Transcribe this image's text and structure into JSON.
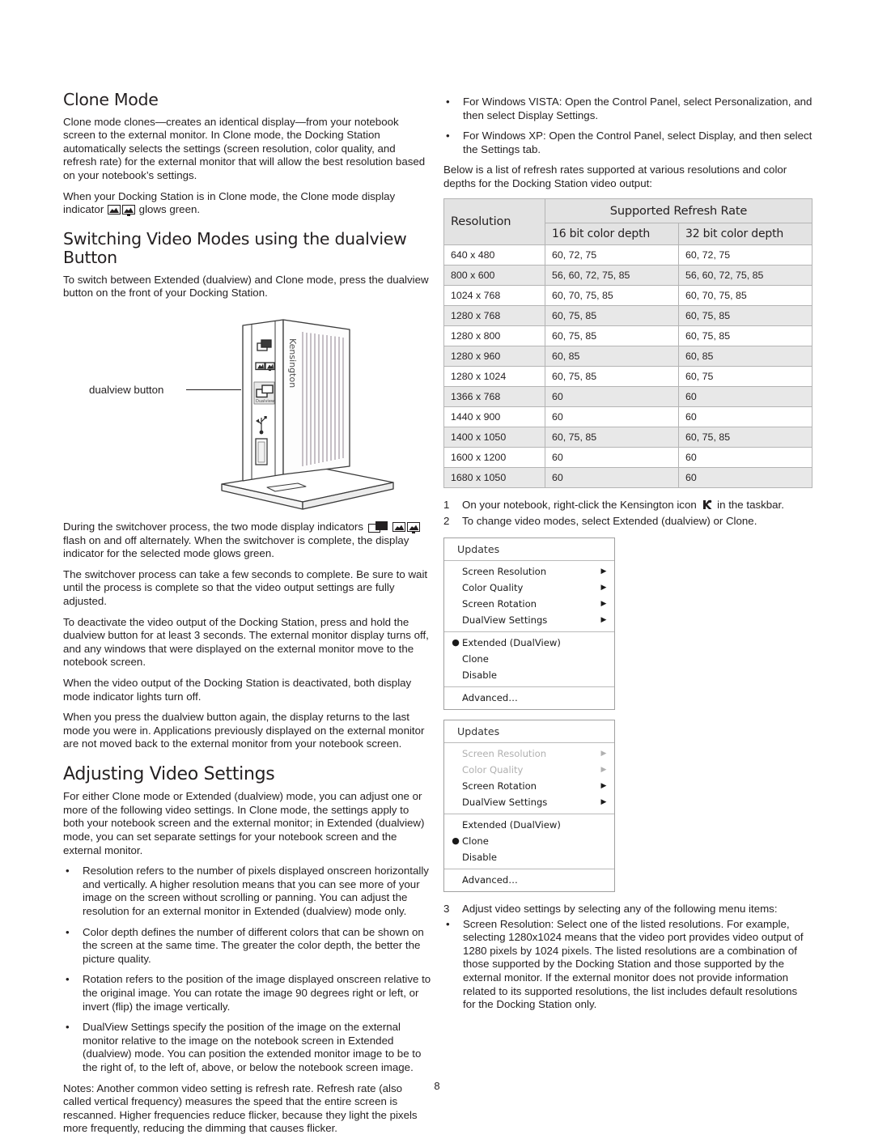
{
  "left": {
    "clone_heading": "Clone Mode",
    "clone_p1": "Clone mode clones—creates an identical display—from your notebook screen to the external monitor. In Clone mode, the Docking Station automatically selects the settings (screen resolution, color quality, and refresh rate) for the external monitor that will allow the best resolution based on your notebook’s settings.",
    "clone_p2_a": "When your Docking Station is in Clone mode, the Clone mode display indicator",
    "clone_p2_b": "glows green.",
    "switch_heading": "Switching Video Modes using the dualview Button",
    "switch_p1": "To switch between Extended (dualview) and Clone mode, press the dualview button on the front of your Docking Station.",
    "figure_callout": "dualview button",
    "figure_brandtext": "Kensington",
    "figure_button_label": "Dualview",
    "switchover_a": "During the switchover process, the two mode display indicators",
    "switchover_b": "flash on and off alternately. When the switchover is complete, the display indicator for the selected mode glows green.",
    "p_wait": "The switchover process can take a few seconds to complete. Be sure to wait until the process is complete so that the video output settings are fully adjusted.",
    "p_deactivate": "To deactivate the video output of the Docking Station, press and hold the dualview button for at least 3 seconds. The external monitor display turns off, and any windows that were displayed on the external monitor move to the notebook screen.",
    "p_lightsoff": "When the video output of the Docking Station is deactivated, both display mode indicator lights turn off.",
    "p_pressagain": "When you press the dualview button again, the display returns to the last mode you were in. Applications previously displayed on the external monitor are not moved back to the external monitor from your notebook screen.",
    "adjust_heading": "Adjusting Video Settings",
    "adjust_p1": "For either Clone mode or Extended (dualview) mode, you can adjust one or more of the following video settings. In Clone mode, the settings apply to both your notebook screen and the external monitor; in Extended (dualview) mode, you can set separate settings for your notebook screen and the external monitor.",
    "bullet_marker": "•",
    "bullets": [
      "Resolution refers to the number of pixels displayed onscreen horizontally and vertically. A higher resolution means that you can see more of your image on the screen without scrolling or panning. You can adjust the resolution for an external monitor in Extended (dualview) mode only.",
      "Color depth defines the number of different colors that can be shown on the screen at the same time. The greater the color depth, the better the picture quality.",
      "Rotation refers to the position of the image displayed onscreen relative to the original image. You can rotate the image 90 degrees right or left, or invert (flip) the image vertically.",
      "DualView Settings specify the position of the image on the external monitor relative to the image on the notebook screen in Extended (dualview) mode. You can position the extended monitor image to be to the right of, to the left of, above, or below the notebook screen image."
    ],
    "notes": "Notes: Another common video setting is refresh rate. Refresh rate (also called vertical frequency) measures the speed that the entire screen is rescanned. Higher frequencies reduce flicker, because they light the pixels more frequently, reducing the dimming that causes flicker."
  },
  "right": {
    "bullet_marker": "•",
    "os_bullets": [
      "For Windows VISTA: Open the Control Panel, select Personalization, and then select Display Settings.",
      "For Windows XP: Open the Control Panel, select Display, and then select the Settings tab."
    ],
    "intro": "Below is a list of refresh rates supported at various resolutions and color depths for the Docking Station video output:",
    "steps": [
      {
        "n": "1",
        "a": "On your notebook, right-click the Kensington icon",
        "b": "in the taskbar."
      },
      {
        "n": "2",
        "a": "To change video modes, select Extended (dualview) or Clone.",
        "b": ""
      }
    ],
    "step3": {
      "n": "3",
      "text": "Adjust video settings by selecting any of the following menu items:"
    },
    "step3_bullet": "Screen Resolution: Select one of the listed resolutions. For example, selecting 1280x1024 means that the video port provides video output of 1280 pixels by 1024 pixels. The listed resolutions are a combination of those supported by the Docking Station and those supported by the external monitor. If the external monitor does not provide information related to its supported resolutions, the list includes default resolutions for the Docking Station only."
  },
  "table": {
    "col_resolution": "Resolution",
    "col_group": "Supported Refresh Rate",
    "col_16": "16 bit color depth",
    "col_32": "32 bit color depth",
    "rows": [
      {
        "res": "640 x 480",
        "d16": "60, 72, 75",
        "d32": "60, 72, 75"
      },
      {
        "res": "800 x 600",
        "d16": "56, 60, 72, 75, 85",
        "d32": "56, 60, 72, 75, 85"
      },
      {
        "res": "1024 x 768",
        "d16": "60, 70, 75, 85",
        "d32": "60, 70, 75, 85"
      },
      {
        "res": "1280 x 768",
        "d16": "60, 75, 85",
        "d32": "60, 75, 85"
      },
      {
        "res": "1280 x 800",
        "d16": "60, 75, 85",
        "d32": "60, 75, 85"
      },
      {
        "res": "1280 x 960",
        "d16": "60, 85",
        "d32": "60, 85"
      },
      {
        "res": "1280 x 1024",
        "d16": "60, 75, 85",
        "d32": "60, 75"
      },
      {
        "res": "1366 x 768",
        "d16": "60",
        "d32": "60"
      },
      {
        "res": "1440 x 900",
        "d16": "60",
        "d32": "60"
      },
      {
        "res": "1400 x 1050",
        "d16": "60, 75, 85",
        "d32": "60, 75, 85"
      },
      {
        "res": "1600 x 1200",
        "d16": "60",
        "d32": "60"
      },
      {
        "res": "1680 x 1050",
        "d16": "60",
        "d32": "60"
      }
    ]
  },
  "menu1": {
    "title": "Updates",
    "submenu_items": [
      {
        "label": "Screen Resolution",
        "dim": false
      },
      {
        "label": "Color Quality",
        "dim": false
      },
      {
        "label": "Screen Rotation",
        "dim": false
      },
      {
        "label": "DualView Settings",
        "dim": false
      }
    ],
    "modes": [
      {
        "label": "Extended (DualView)",
        "selected": true
      },
      {
        "label": "Clone",
        "selected": false
      },
      {
        "label": "Disable",
        "selected": false
      }
    ],
    "advanced": "Advanced…",
    "arrow_glyph": "▶",
    "radio_glyph": "●"
  },
  "menu2": {
    "title": "Updates",
    "submenu_items": [
      {
        "label": "Screen Resolution",
        "dim": true
      },
      {
        "label": "Color Quality",
        "dim": true
      },
      {
        "label": "Screen Rotation",
        "dim": false
      },
      {
        "label": "DualView Settings",
        "dim": false
      }
    ],
    "modes": [
      {
        "label": "Extended (DualView)",
        "selected": false
      },
      {
        "label": "Clone",
        "selected": true
      },
      {
        "label": "Disable",
        "selected": false
      }
    ],
    "advanced": "Advanced…",
    "arrow_glyph": "▶",
    "radio_glyph": "●"
  },
  "footer": {
    "page_number": "8"
  }
}
